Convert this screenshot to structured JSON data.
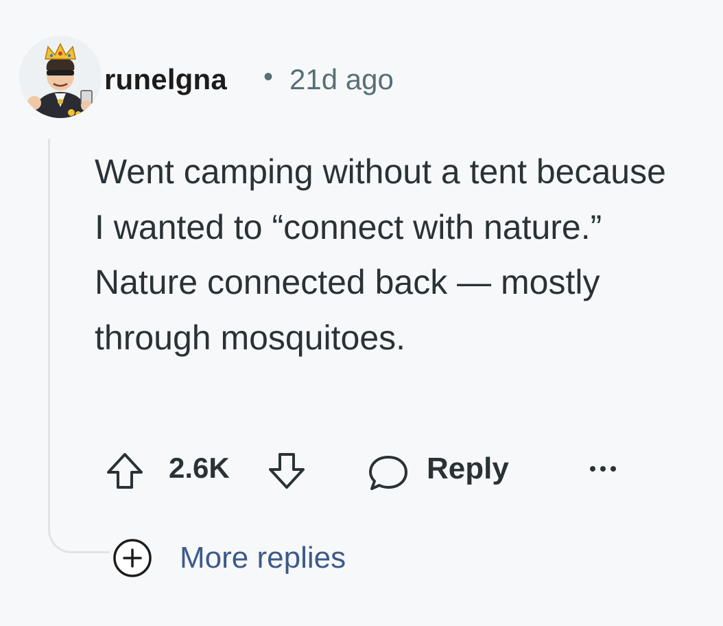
{
  "comment": {
    "username": "runelgna",
    "separator": "•",
    "timestamp": "21d ago",
    "body": "Went camping without a tent because I wanted to “connect with nature.” Nature connected back — mostly through mosquitoes.",
    "avatar_icon": "avatar-king-character-icon"
  },
  "actions": {
    "upvote_icon": "arrow-up-icon",
    "score": "2.6K",
    "downvote_icon": "arrow-down-icon",
    "reply_icon": "speech-bubble-icon",
    "reply_label": "Reply",
    "more_icon": "ellipsis-icon"
  },
  "thread": {
    "more_replies_icon": "plus-circle-icon",
    "more_replies_label": "More replies"
  },
  "colors": {
    "background": "#f7f8fa",
    "text_primary": "#2a3236",
    "text_meta": "#576f76",
    "link_blue": "#3c5a8a",
    "thread_line": "#dfe4e8"
  }
}
